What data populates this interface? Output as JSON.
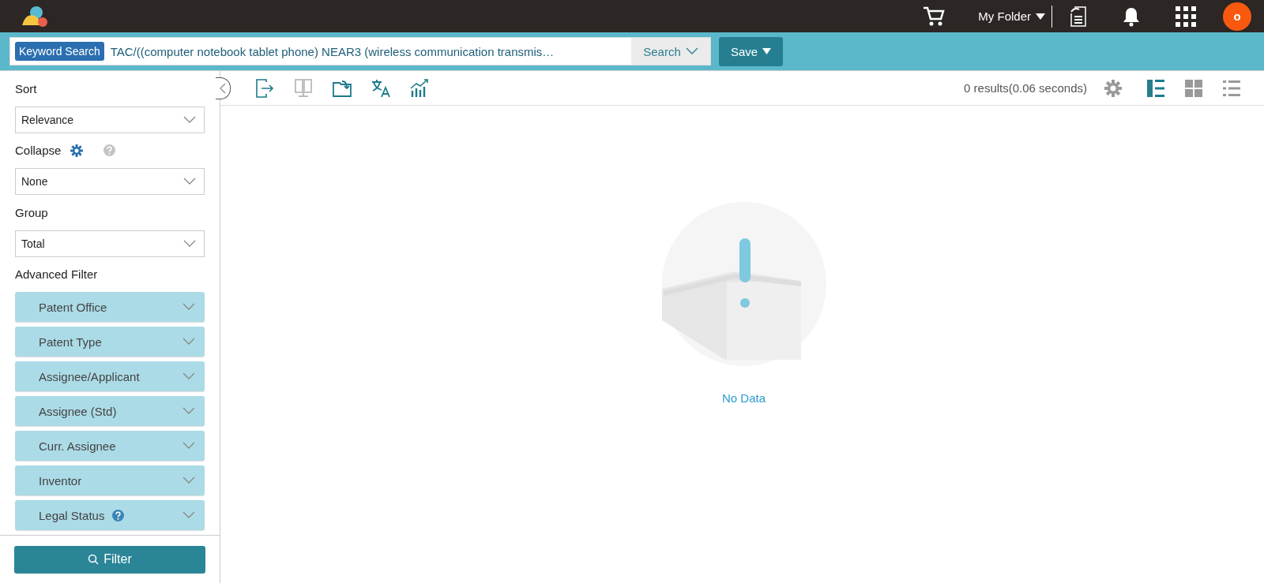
{
  "top_bar": {
    "folder_label": "My Folder",
    "avatar_letter": "o"
  },
  "search_bar": {
    "mode_label": "Keyword Search",
    "query": "TAC/((computer notebook tablet phone) NEAR3 (wireless communication transmis…",
    "search_button": "Search",
    "save_button": "Save"
  },
  "sidebar": {
    "sort": {
      "label": "Sort",
      "value": "Relevance"
    },
    "collapse": {
      "label": "Collapse",
      "value": "None"
    },
    "group": {
      "label": "Group",
      "value": "Total"
    },
    "advanced_filter": {
      "label": "Advanced Filter",
      "items": [
        {
          "label": "Patent Office",
          "help": false
        },
        {
          "label": "Patent Type",
          "help": false
        },
        {
          "label": "Assignee/Applicant",
          "help": false
        },
        {
          "label": "Assignee (Std)",
          "help": false
        },
        {
          "label": "Curr. Assignee",
          "help": false
        },
        {
          "label": "Inventor",
          "help": false
        },
        {
          "label": "Legal Status",
          "help": true
        }
      ]
    },
    "filter_button": "Filter"
  },
  "toolbar": {
    "buttons": [
      {
        "kind": "export",
        "disabled": false
      },
      {
        "kind": "compare",
        "disabled": true
      },
      {
        "kind": "folder",
        "disabled": false
      },
      {
        "kind": "translate",
        "disabled": false
      },
      {
        "kind": "analytics",
        "disabled": false
      }
    ],
    "results": "0 results(0.06 seconds)",
    "views": [
      {
        "kind": "detail",
        "selected": true
      },
      {
        "kind": "grid",
        "selected": false
      },
      {
        "kind": "list",
        "selected": false
      }
    ]
  },
  "empty_state": {
    "message": "No Data"
  }
}
